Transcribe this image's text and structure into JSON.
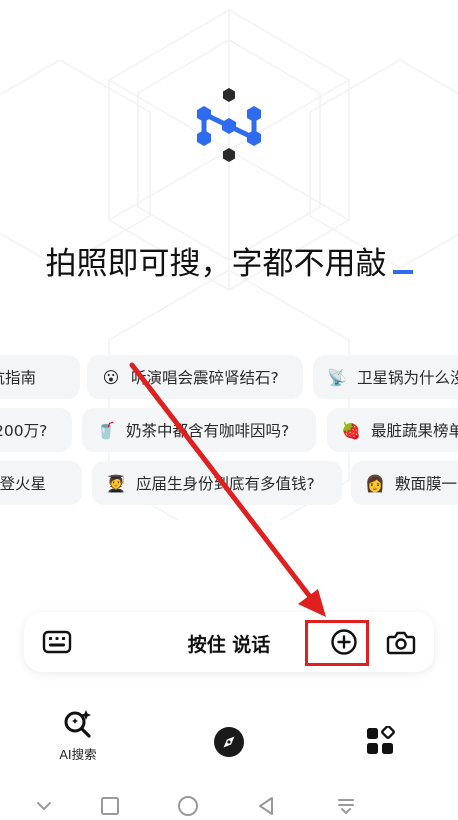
{
  "headline": "拍照即可搜，字都不用敲",
  "suggestions": {
    "row1": [
      {
        "emoji": "",
        "label": "避坑指南"
      },
      {
        "emoji": "😮",
        "label": "听演唱会震碎肾结石?"
      },
      {
        "emoji": "📡",
        "label": "卫星锅为什么没"
      }
    ],
    "row2": [
      {
        "emoji": "",
        "label": "200万?"
      },
      {
        "emoji": "🥤",
        "label": "奶茶中都含有咖啡因吗?"
      },
      {
        "emoji": "🍓",
        "label": "最脏蔬果榜单"
      }
    ],
    "row3": [
      {
        "emoji": "",
        "label": "前登火星"
      },
      {
        "emoji": "🧑‍🎓",
        "label": "应届生身份到底有多值钱?"
      },
      {
        "emoji": "👩",
        "label": "敷面膜一"
      }
    ]
  },
  "input_bar": {
    "voice_label": "按住 说话"
  },
  "bottom_nav": {
    "ai_search_label": "AI搜索"
  },
  "colors": {
    "brand_blue": "#2f6bef",
    "annotation_red": "#e0201e"
  }
}
